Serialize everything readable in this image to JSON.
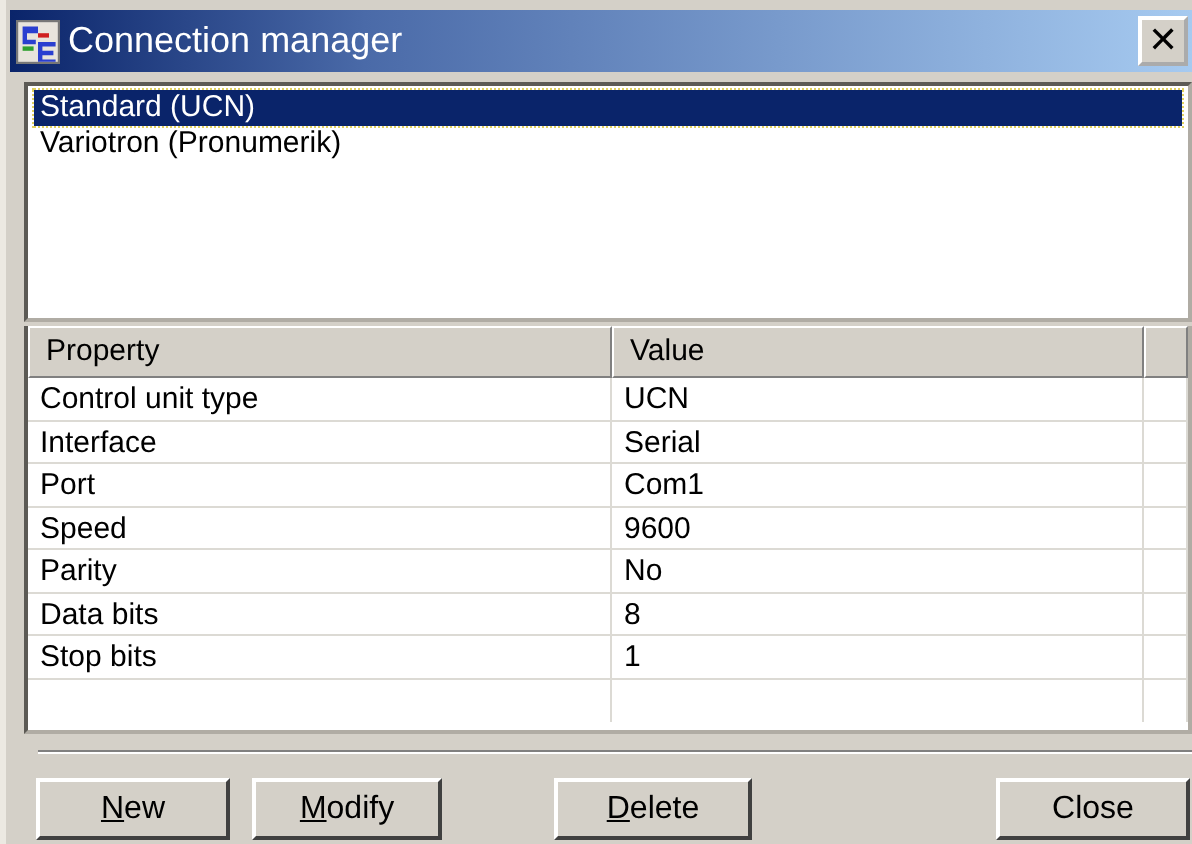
{
  "window": {
    "title": "Connection manager",
    "close": "✕"
  },
  "connections": [
    {
      "label": "Standard (UCN)",
      "selected": true
    },
    {
      "label": "Variotron (Pronumerik)",
      "selected": false
    }
  ],
  "table": {
    "columns": [
      "Property",
      "Value"
    ],
    "rows": [
      [
        "Control unit type",
        "UCN"
      ],
      [
        "Interface",
        "Serial"
      ],
      [
        "Port",
        "Com1"
      ],
      [
        "Speed",
        "9600"
      ],
      [
        "Parity",
        "No"
      ],
      [
        "Data bits",
        "8"
      ],
      [
        "Stop bits",
        "1"
      ]
    ]
  },
  "buttons": [
    {
      "label": "New",
      "underline_first": true
    },
    {
      "label": "Modify",
      "underline_first": true
    },
    {
      "label": "Delete",
      "underline_first": true
    },
    {
      "label": "Close",
      "underline_first": false
    }
  ]
}
